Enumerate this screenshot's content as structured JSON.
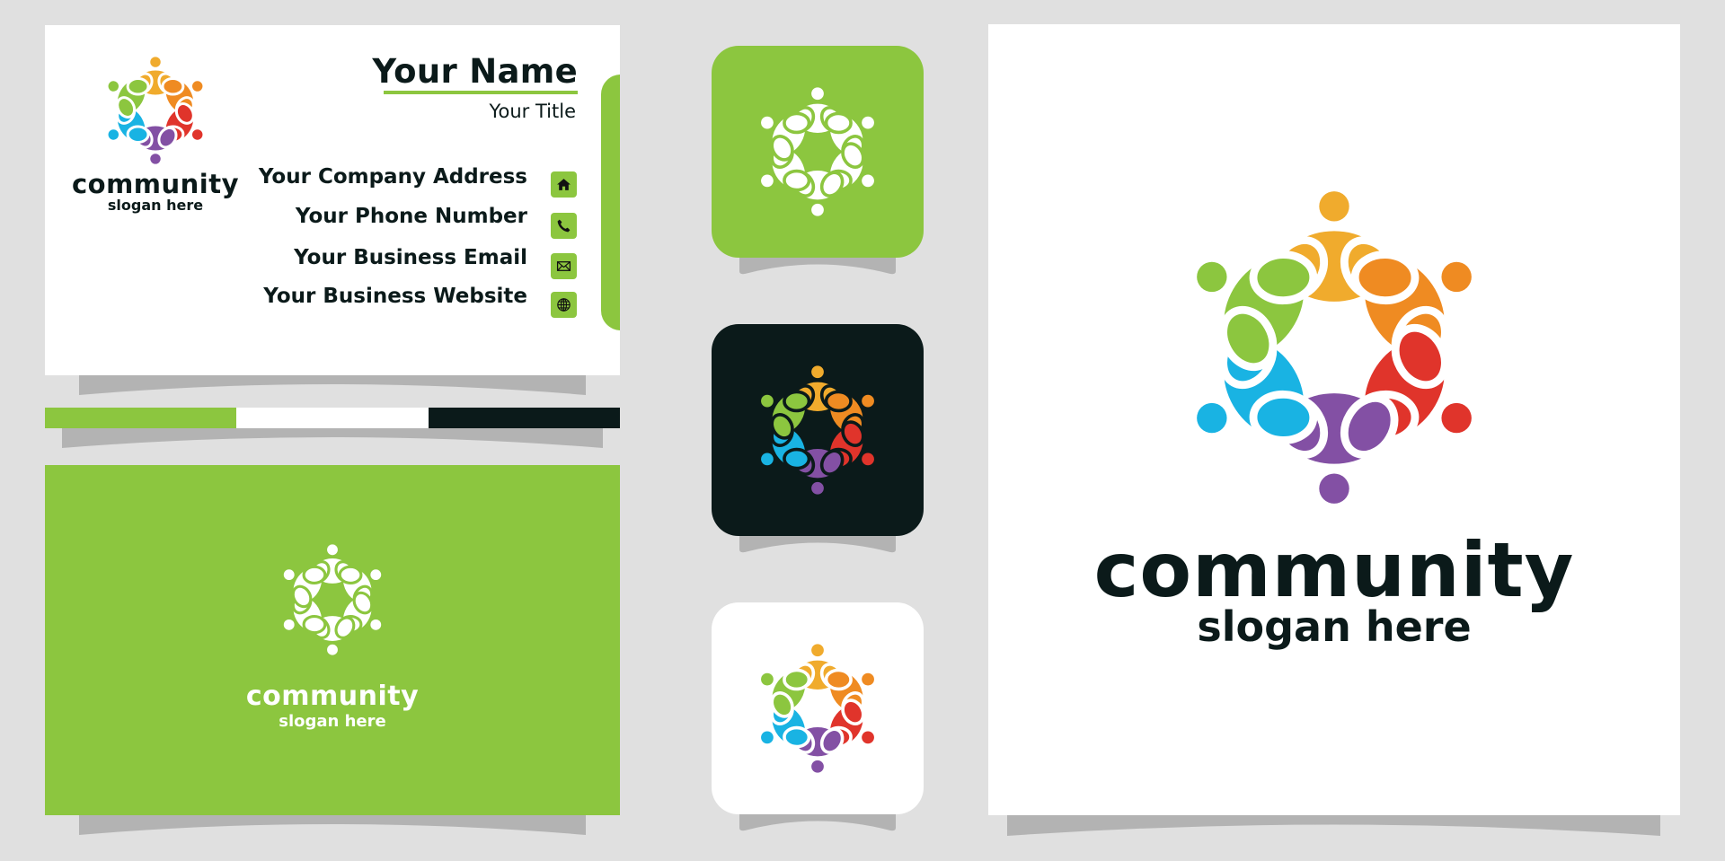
{
  "colors": {
    "background": "#e0e0e0",
    "brand_green": "#8cc63f",
    "brand_dark": "#0b1a1a",
    "white": "#ffffff",
    "shadow": "#b3b3b3"
  },
  "logo": {
    "icon": "community-people-circle-icon",
    "figure_colors": [
      "#f0ab2d",
      "#ef8b22",
      "#e0342b",
      "#8350a4",
      "#19b3e3",
      "#8cc63f"
    ],
    "name": "community",
    "slogan": "slogan here"
  },
  "business_card_front": {
    "name": "Your Name",
    "title": "Your Title",
    "contacts": [
      {
        "label": "Your Company Address",
        "icon": "home-icon"
      },
      {
        "label": "Your Phone Number",
        "icon": "phone-icon"
      },
      {
        "label": "Your Business Email",
        "icon": "email-icon"
      },
      {
        "label": "Your Business Website",
        "icon": "globe-icon"
      }
    ]
  },
  "color_stripe": [
    "#8cc63f",
    "#ffffff",
    "#0b1a1a"
  ],
  "app_icons": [
    {
      "variant": "green",
      "background": "#8cc63f",
      "logo_style": "white"
    },
    {
      "variant": "dark",
      "background": "#0b1a1a",
      "logo_style": "color-dark-stroke"
    },
    {
      "variant": "white",
      "background": "#ffffff",
      "logo_style": "color"
    }
  ]
}
